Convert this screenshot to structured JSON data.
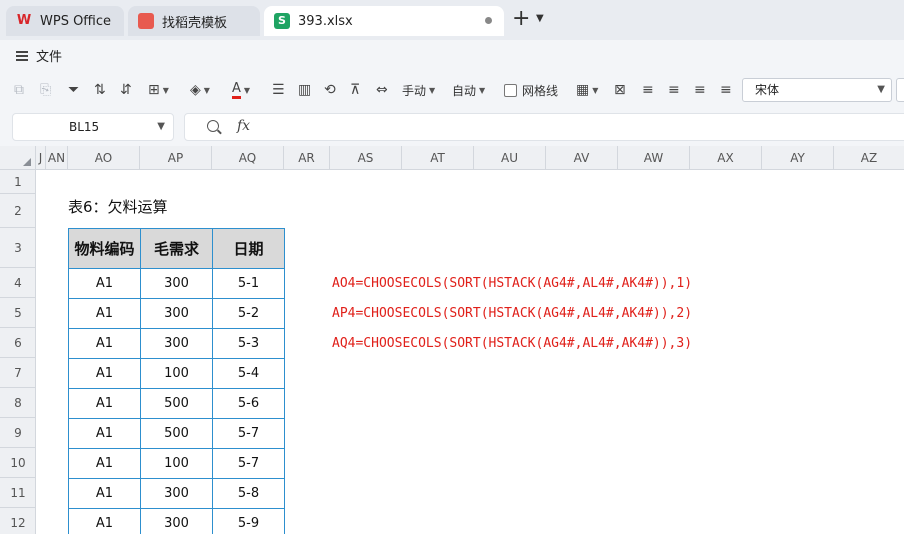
{
  "tabs": [
    {
      "label": "WPS Office",
      "icon": "wps-logo-icon"
    },
    {
      "label": "找稻壳模板",
      "icon": "docer-icon"
    },
    {
      "label": "393.xlsx",
      "icon": "spreadsheet-icon"
    }
  ],
  "menu": {
    "file_label": "文件"
  },
  "toolbar": {
    "manual_label": "手动",
    "auto_label": "自动",
    "gridlines_label": "网格线",
    "font_name": "宋体",
    "font_color": "#e0201a"
  },
  "formula_bar": {
    "cell_ref": "BL15",
    "fx": "fx",
    "content": ""
  },
  "columns": [
    "J",
    "AN",
    "AO",
    "AP",
    "AQ",
    "AR",
    "AS",
    "AT",
    "AU",
    "AV",
    "AW",
    "AX",
    "AY",
    "AZ"
  ],
  "rows": [
    "1",
    "2",
    "3",
    "4",
    "5",
    "6",
    "7",
    "8",
    "9",
    "10",
    "11",
    "12"
  ],
  "sheet": {
    "title": "表6：欠料运算",
    "table": {
      "headers": [
        "物料编码",
        "毛需求",
        "日期"
      ],
      "rows": [
        [
          "A1",
          "300",
          "5-1"
        ],
        [
          "A1",
          "300",
          "5-2"
        ],
        [
          "A1",
          "300",
          "5-3"
        ],
        [
          "A1",
          "100",
          "5-4"
        ],
        [
          "A1",
          "500",
          "5-6"
        ],
        [
          "A1",
          "500",
          "5-7"
        ],
        [
          "A1",
          "100",
          "5-7"
        ],
        [
          "A1",
          "300",
          "5-8"
        ],
        [
          "A1",
          "300",
          "5-9"
        ]
      ]
    },
    "formulas": [
      "AO4=CHOOSECOLS(SORT(HSTACK(AG4#,AL4#,AK4#)),1)",
      "AP4=CHOOSECOLS(SORT(HSTACK(AG4#,AL4#,AK4#)),2)",
      "AQ4=CHOOSECOLS(SORT(HSTACK(AG4#,AL4#,AK4#)),3)"
    ]
  }
}
